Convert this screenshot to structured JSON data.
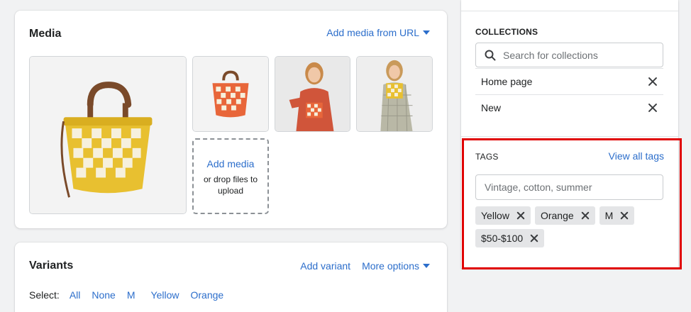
{
  "media": {
    "title": "Media",
    "add_url_label": "Add media from URL",
    "drop_add_label": "Add media",
    "drop_hint": "or drop files to upload",
    "images": [
      {
        "alt": "yellow-checkered-bucket-bag"
      },
      {
        "alt": "orange-checkered-bucket-bag"
      },
      {
        "alt": "model-with-orange-bag"
      },
      {
        "alt": "model-with-yellow-bag"
      }
    ]
  },
  "variants": {
    "title": "Variants",
    "add_variant": "Add variant",
    "more_options": "More options",
    "select_label": "Select:",
    "select_options": [
      "All",
      "None",
      "M",
      "Yellow",
      "Orange"
    ]
  },
  "collections": {
    "label": "COLLECTIONS",
    "search_placeholder": "Search for collections",
    "items": [
      "Home page",
      "New"
    ]
  },
  "tags": {
    "label": "TAGS",
    "view_all": "View all tags",
    "input_placeholder": "Vintage, cotton, summer",
    "items": [
      "Yellow",
      "Orange",
      "M",
      "$50-$100"
    ]
  },
  "colors": {
    "accent": "#2c6ecb",
    "highlight": "#e00000",
    "bag_yellow": "#e8c030",
    "bag_orange": "#e8663a"
  }
}
